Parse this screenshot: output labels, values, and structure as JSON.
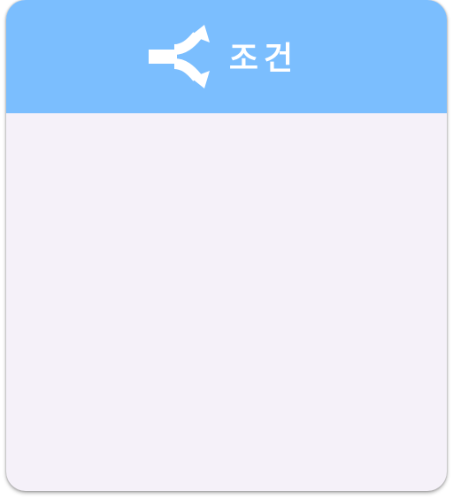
{
  "card": {
    "title": "조건",
    "icon": "split-arrow-icon",
    "colors": {
      "header": "#7bbefe",
      "body": "#f5f1f9",
      "title": "#ffffff"
    }
  }
}
